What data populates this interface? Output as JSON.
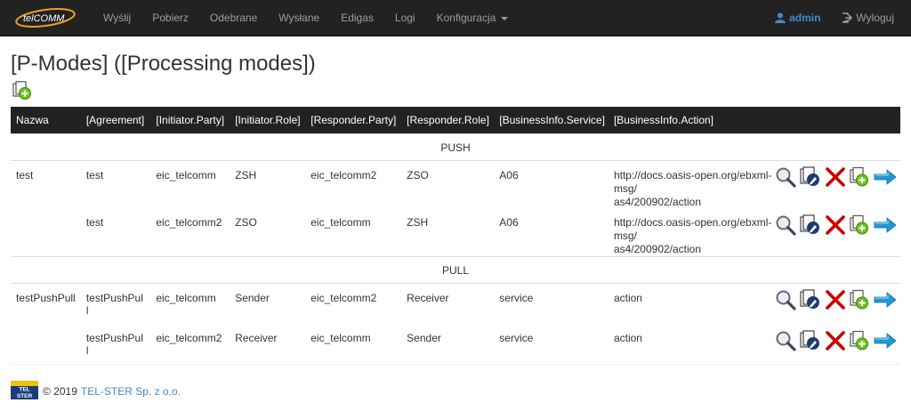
{
  "nav": {
    "brand_text": "telCOMM",
    "items": [
      "Wyślij",
      "Pobierz",
      "Odebrane",
      "Wysłane",
      "Edigas",
      "Logi",
      "Konfiguracja"
    ],
    "user": "admin",
    "logout": "Wyloguj"
  },
  "page": {
    "title": "[P-Modes] ([Processing modes])"
  },
  "table": {
    "headers": [
      "Nazwa",
      "[Agreement]",
      "[Initiator.Party]",
      "[Initiator.Role]",
      "[Responder.Party]",
      "[Responder.Role]",
      "[BusinessInfo.Service]",
      "[BusinessInfo.Action]"
    ],
    "groups": [
      {
        "label": "PUSH",
        "rows": [
          [
            "test",
            "test",
            "eic_telcomm",
            "ZSH",
            "eic_telcomm2",
            "ZSO",
            "A06",
            "http://docs.oasis-open.org/ebxml-msg/\nas4/200902/action"
          ],
          [
            "",
            "test",
            "eic_telcomm2",
            "ZSO",
            "eic_telcomm",
            "ZSH",
            "A06",
            "http://docs.oasis-open.org/ebxml-msg/\nas4/200902/action"
          ]
        ]
      },
      {
        "label": "PULL",
        "rows": [
          [
            "testPushPull",
            "testPushPul\nl",
            "eic_telcomm",
            "Sender",
            "eic_telcomm2",
            "Receiver",
            "service",
            "action"
          ],
          [
            "",
            "testPushPul\nl",
            "eic_telcomm2",
            "Receiver",
            "eic_telcomm",
            "Sender",
            "service",
            "action"
          ]
        ]
      }
    ]
  },
  "footer": {
    "copyright": "© 2019",
    "company": "TEL-STER Sp. z o.o.",
    "logo_text": "TEL STER"
  },
  "colors": {
    "navbar": "#222222",
    "link": "#428bca",
    "delete": "#cc0000",
    "arrow": "#1e9ad6",
    "add": "#6cc417"
  }
}
